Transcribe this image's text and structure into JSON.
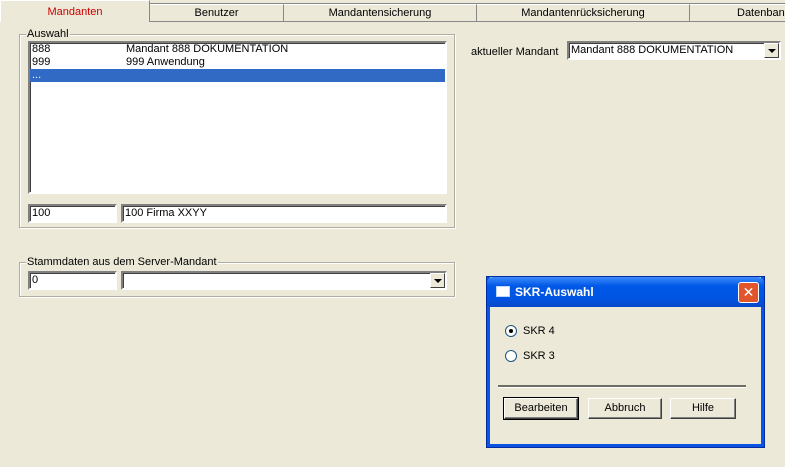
{
  "tabs": [
    {
      "label": "Mandanten",
      "active": true
    },
    {
      "label": "Benutzer"
    },
    {
      "label": "Mandantensicherung"
    },
    {
      "label": "Mandantenrücksicherung"
    },
    {
      "label": "Datenban"
    }
  ],
  "auswahl": {
    "title": "Auswahl",
    "rows": [
      {
        "nr": "888",
        "name": "Mandant 888 DOKUMENTATION"
      },
      {
        "nr": "999",
        "name": "999 Anwendung"
      },
      {
        "nr": "...",
        "name": "",
        "selected": true
      }
    ],
    "nr_value": "100",
    "name_value": "100 Firma XXYY"
  },
  "current": {
    "label": "aktueller Mandant",
    "value": "Mandant 888 DOKUMENTATION"
  },
  "stamm": {
    "title": "Stammdaten aus dem Server-Mandant",
    "nr_value": "0",
    "combo_value": ""
  },
  "dialog": {
    "title": "SKR-Auswahl",
    "close": "✕",
    "options": [
      "SKR 4",
      "SKR 3"
    ],
    "selected_option": "SKR 4",
    "buttons": {
      "edit": "Bearbeiten",
      "cancel": "Abbruch",
      "help": "Hilfe"
    }
  }
}
